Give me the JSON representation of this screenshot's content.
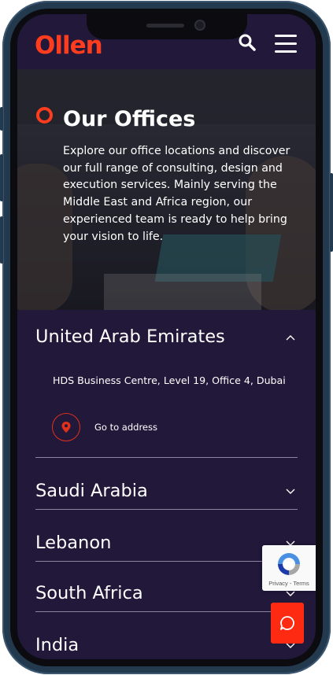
{
  "header": {
    "logo": "Ollen",
    "icons": [
      "search-icon",
      "hamburger-menu-icon"
    ]
  },
  "hero": {
    "title": "Our Offices",
    "description": "Explore our office locations and discover our full range of consulting, design and execution services. Mainly serving the Middle East and Africa region, our experienced team is ready to help bring your vision to life."
  },
  "offices": {
    "uae": {
      "name": "United Arab Emirates",
      "address": "HDS Business Centre, Level 19, Office 4, Dubai",
      "cta": "Go to address",
      "expanded": true
    },
    "items": [
      {
        "name": "Saudi Arabia"
      },
      {
        "name": "Lebanon"
      },
      {
        "name": "South Africa"
      },
      {
        "name": "India"
      }
    ]
  },
  "recaptcha": {
    "terms": "Privacy - Terms"
  },
  "colors": {
    "accent": "#ff3d1e",
    "background": "#21183a",
    "text": "#ffffff"
  }
}
